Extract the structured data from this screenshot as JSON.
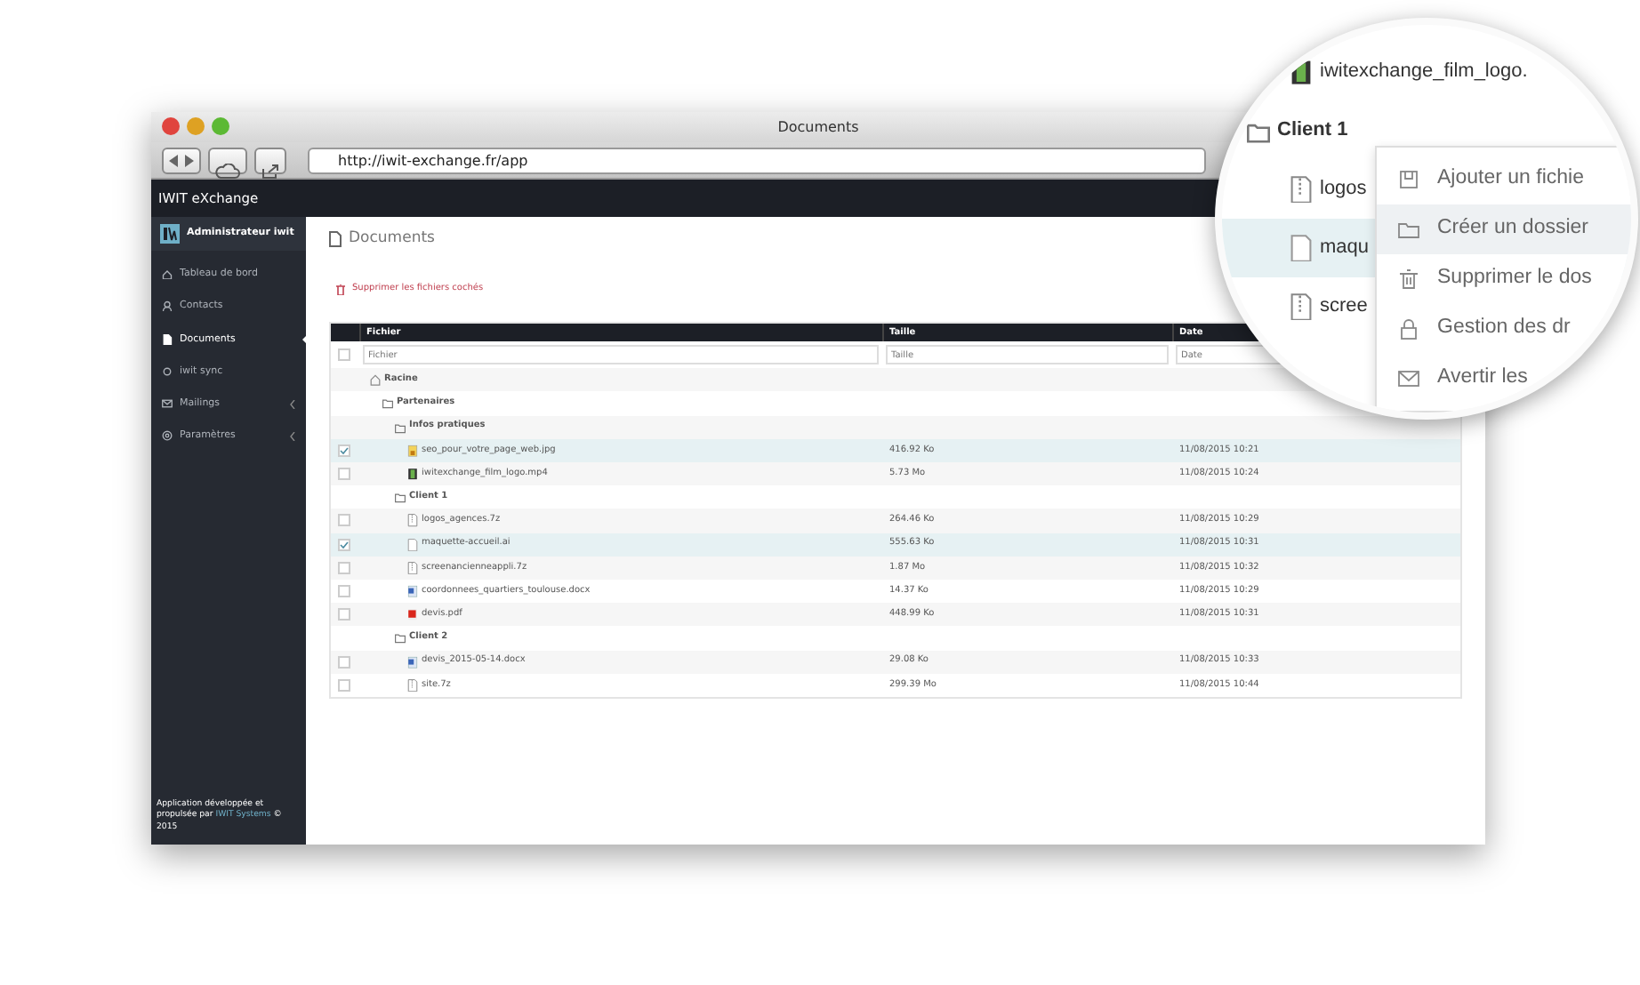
{
  "window": {
    "title": "Documents",
    "url": "http://iwit-exchange.fr/app"
  },
  "app": {
    "brand": "IWIT eXchange",
    "user": "Administrateur iwit",
    "nav": [
      {
        "label": "Tableau de bord",
        "selected": false,
        "submenu": false
      },
      {
        "label": "Contacts",
        "selected": false,
        "submenu": false
      },
      {
        "label": "Documents",
        "selected": true,
        "submenu": false
      },
      {
        "label": "iwit sync",
        "selected": false,
        "submenu": false
      },
      {
        "label": "Mailings",
        "selected": false,
        "submenu": true
      },
      {
        "label": "Paramètres",
        "selected": false,
        "submenu": true
      }
    ],
    "footer": {
      "text": "Application développée et propulsée par",
      "link": "IWIT Systems",
      "after": "© 2015"
    }
  },
  "page": {
    "title": "Documents",
    "action": "Supprimer les fichiers cochés"
  },
  "table": {
    "columns": [
      "Fichier",
      "Taille",
      "Date"
    ],
    "select_all_checked": false,
    "filters": [
      {
        "placeholder": "Fichier"
      },
      {
        "placeholder": "Taille"
      },
      {
        "placeholder": "Date"
      }
    ],
    "tree": [
      {
        "kind": "root",
        "name": "Racine",
        "children": [
          {
            "kind": "folder",
            "name": "Partenaires",
            "children": [
              {
                "kind": "folder",
                "name": "Infos pratiques",
                "children": [
                  {
                    "kind": "image",
                    "name": "seo_pour_votre_page_web.jpg",
                    "size": "416.92 Ko",
                    "date": "11/08/2015 10:21",
                    "checked": true
                  },
                  {
                    "kind": "video",
                    "name": "iwitexchange_film_logo.mp4",
                    "size": "5.73 Mo",
                    "date": "11/08/2015 10:24",
                    "checked": false
                  }
                ]
              },
              {
                "kind": "folder",
                "name": "Client 1",
                "children": [
                  {
                    "kind": "archive",
                    "name": "logos_agences.7z",
                    "size": "264.46 Ko",
                    "date": "11/08/2015 10:29",
                    "checked": false
                  },
                  {
                    "kind": "file",
                    "name": "maquette-accueil.ai",
                    "size": "555.63 Ko",
                    "date": "11/08/2015 10:31",
                    "checked": true
                  },
                  {
                    "kind": "archive",
                    "name": "screenancienneappli.7z",
                    "size": "1.87 Mo",
                    "date": "11/08/2015 10:32",
                    "checked": false
                  },
                  {
                    "kind": "word",
                    "name": "coordonnees_quartiers_toulouse.docx",
                    "size": "14.37 Ko",
                    "date": "11/08/2015 10:29",
                    "checked": false
                  },
                  {
                    "kind": "pdf",
                    "name": "devis.pdf",
                    "size": "448.99 Ko",
                    "date": "11/08/2015 10:31",
                    "checked": false
                  }
                ]
              },
              {
                "kind": "folder",
                "name": "Client 2",
                "children": [
                  {
                    "kind": "word",
                    "name": "devis_2015-05-14.docx",
                    "size": "29.08 Ko",
                    "date": "11/08/2015 10:33",
                    "checked": false
                  },
                  {
                    "kind": "archive",
                    "name": "site.7z",
                    "size": "299.39 Mo",
                    "date": "11/08/2015 10:44",
                    "checked": false
                  }
                ]
              }
            ]
          }
        ]
      }
    ]
  },
  "magnifier": {
    "rows": [
      {
        "kind": "video",
        "name": "iwitexchange_film_logo.",
        "selected": false
      },
      {
        "kind": "folder",
        "name": "Client 1",
        "selected": false
      },
      {
        "kind": "archive",
        "name": "logos",
        "selected": false
      },
      {
        "kind": "file",
        "name": "maqu",
        "selected": true
      },
      {
        "kind": "archive",
        "name": "scree",
        "selected": false
      }
    ],
    "menu": [
      {
        "label": "Ajouter un fichie",
        "selected": false
      },
      {
        "label": "Créer un dossier",
        "selected": true
      },
      {
        "label": "Supprimer le dos",
        "selected": false
      },
      {
        "label": "Gestion des dr",
        "selected": false
      },
      {
        "label": "Avertir les",
        "selected": false
      }
    ]
  }
}
